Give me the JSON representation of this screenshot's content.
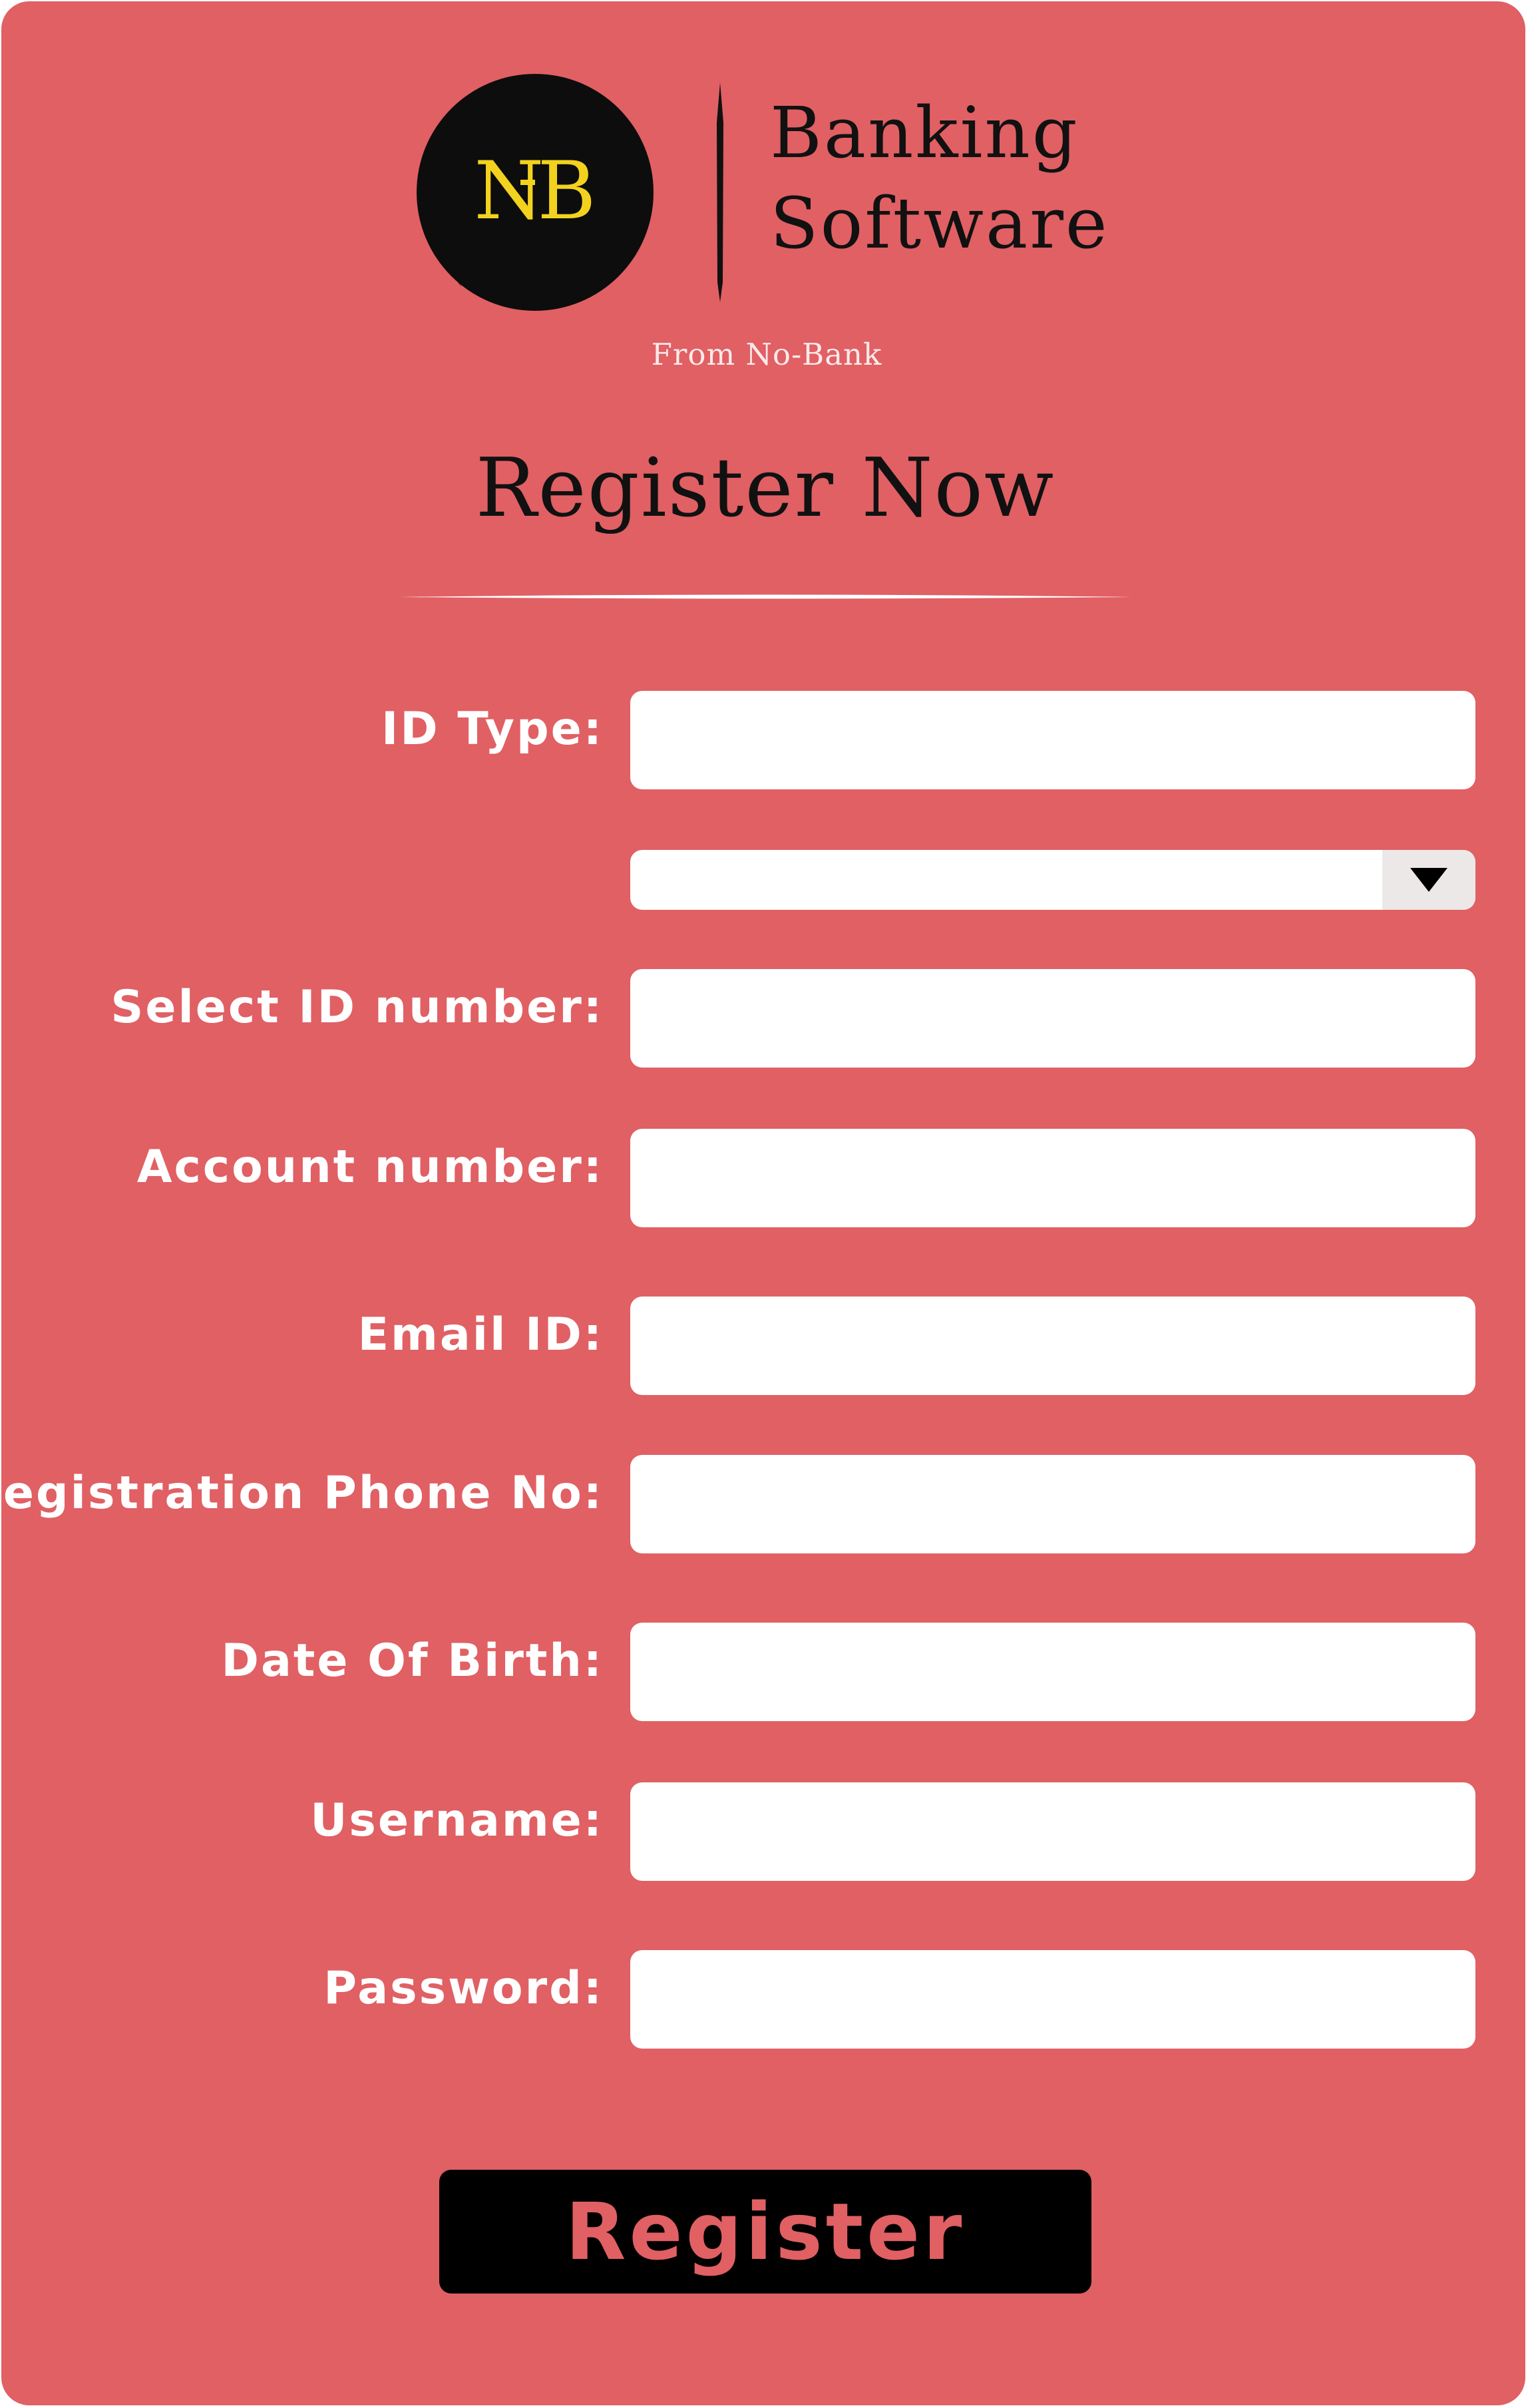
{
  "brand": {
    "logo_monogram": "NB",
    "name_line1": "Banking",
    "name_line2": "Software",
    "tagline": "From No-Bank"
  },
  "page": {
    "title": "Register Now"
  },
  "form": {
    "id_type_label": "ID Type:",
    "id_type_value": "",
    "id_type_select_value": "",
    "select_id_number_label": "Select ID number:",
    "select_id_number_value": "",
    "account_number_label": "Account number:",
    "account_number_value": "",
    "email_id_label": "Email ID:",
    "email_id_value": "",
    "registration_phone_label": "Registration Phone No:",
    "registration_phone_value": "",
    "date_of_birth_label": "Date Of Birth:",
    "date_of_birth_value": "",
    "username_label": "Username:",
    "username_value": "",
    "password_label": "Password:",
    "password_value": ""
  },
  "actions": {
    "register_label": "Register"
  },
  "colors": {
    "background": "#e06064",
    "logo_circle": "#0d0d0d",
    "logo_monogram": "#f2d21e",
    "input_background": "#ffffff",
    "button_background": "#000000",
    "button_text": "#e06064"
  },
  "icons": {
    "dropdown": "triangle-down"
  }
}
